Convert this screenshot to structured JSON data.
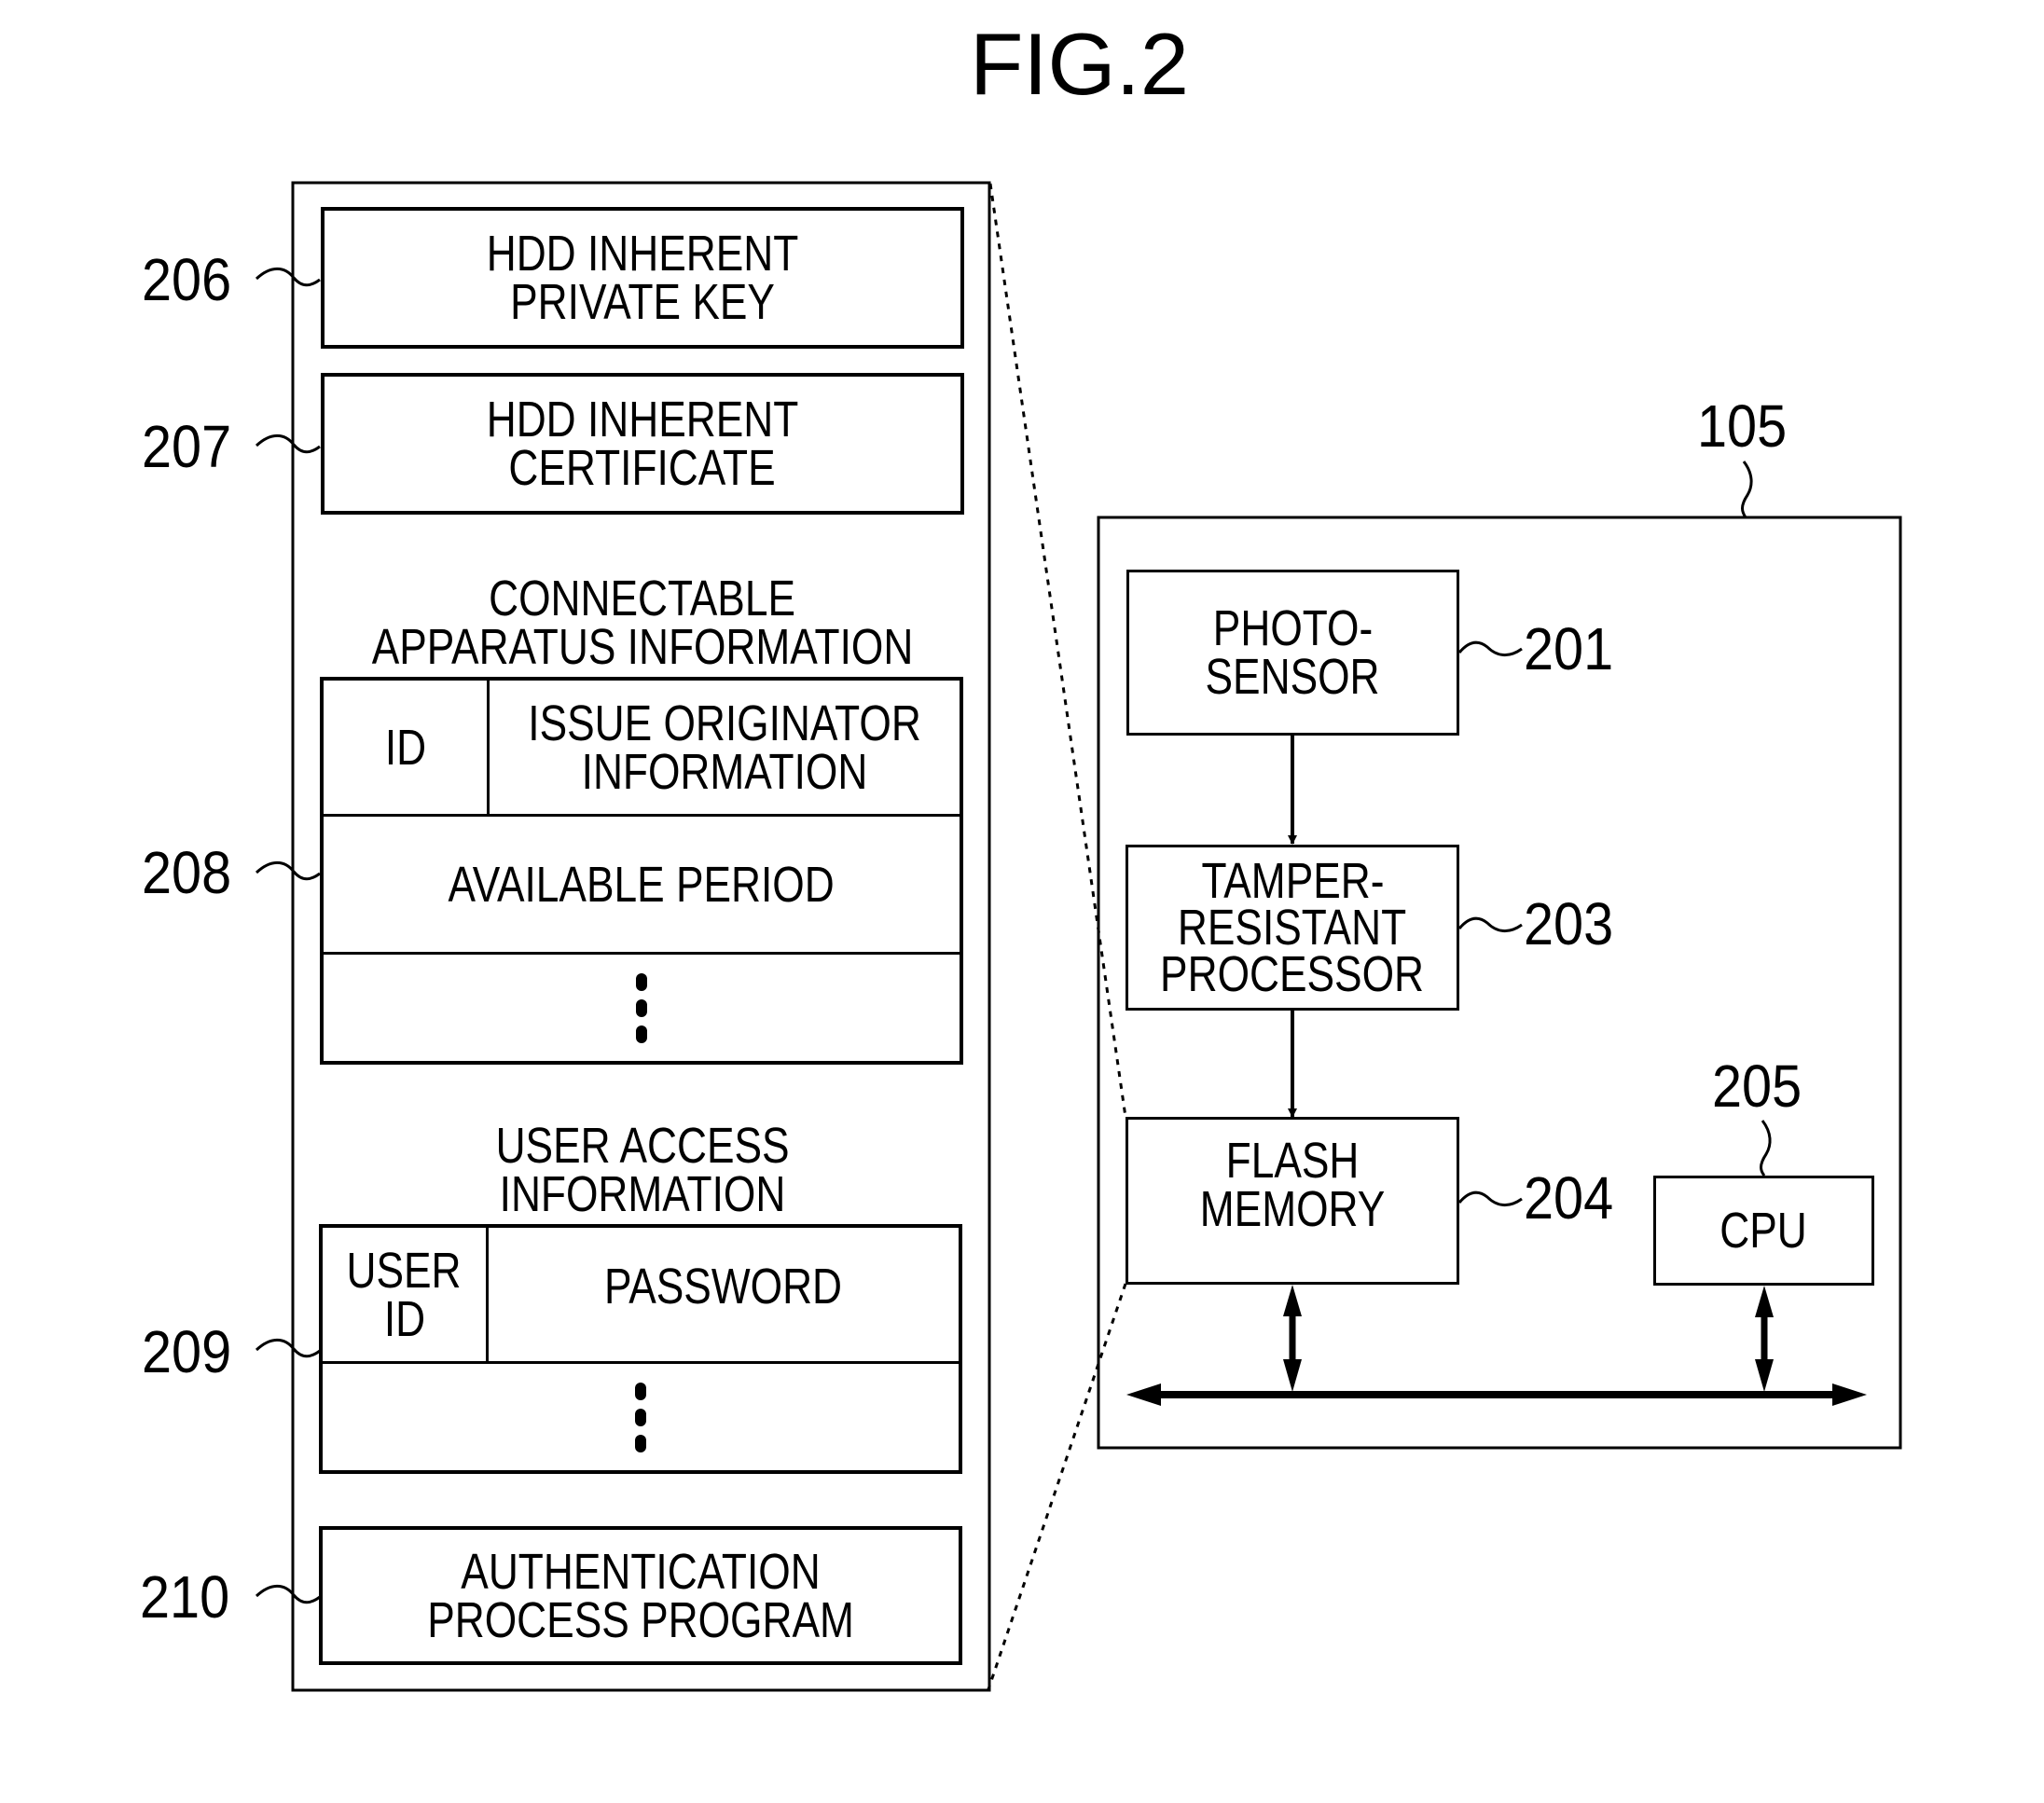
{
  "figure": {
    "title": "FIG.2"
  },
  "storage_panel": {
    "items": [
      {
        "ref": "206",
        "lines": [
          "HDD INHERENT",
          "PRIVATE KEY"
        ]
      },
      {
        "ref": "207",
        "lines": [
          "HDD INHERENT",
          "CERTIFICATE"
        ]
      }
    ],
    "connectable_apparatus": {
      "ref": "208",
      "heading": [
        "CONNECTABLE",
        "APPARATUS INFORMATION"
      ],
      "row1": {
        "col1": [
          "ID"
        ],
        "col2": [
          "ISSUE ORIGINATOR",
          "INFORMATION"
        ]
      },
      "row2": [
        "AVAILABLE PERIOD"
      ],
      "continuation": "vertical-ellipsis"
    },
    "user_access": {
      "ref": "209",
      "heading": [
        "USER ACCESS",
        "INFORMATION"
      ],
      "row1": {
        "col1": [
          "USER",
          "ID"
        ],
        "col2": [
          "PASSWORD"
        ]
      },
      "continuation": "vertical-ellipsis"
    },
    "auth_program": {
      "ref": "210",
      "lines": [
        "AUTHENTICATION",
        "PROCESS PROGRAM"
      ]
    }
  },
  "device_panel": {
    "ref": "105",
    "blocks": [
      {
        "id": "photo_sensor",
        "ref": "201",
        "lines": [
          "PHOTO-",
          "SENSOR"
        ]
      },
      {
        "id": "tamper_processor",
        "ref": "203",
        "lines": [
          "TAMPER-",
          "RESISTANT",
          "PROCESSOR"
        ]
      },
      {
        "id": "flash_memory",
        "ref": "204",
        "lines": [
          "FLASH",
          "MEMORY"
        ]
      },
      {
        "id": "cpu",
        "ref": "205",
        "lines": [
          "CPU"
        ]
      }
    ],
    "connections": [
      {
        "from": "photo_sensor",
        "to": "tamper_processor",
        "type": "arrow"
      },
      {
        "from": "tamper_processor",
        "to": "flash_memory",
        "type": "arrow"
      },
      {
        "from": "flash_memory",
        "to": "bus",
        "type": "bidirectional"
      },
      {
        "from": "cpu",
        "to": "bus",
        "type": "bidirectional"
      }
    ],
    "bus": {
      "type": "bidirectional"
    },
    "zoom_link": {
      "from": "flash_memory",
      "to": "storage_panel",
      "style": "dotted"
    }
  }
}
